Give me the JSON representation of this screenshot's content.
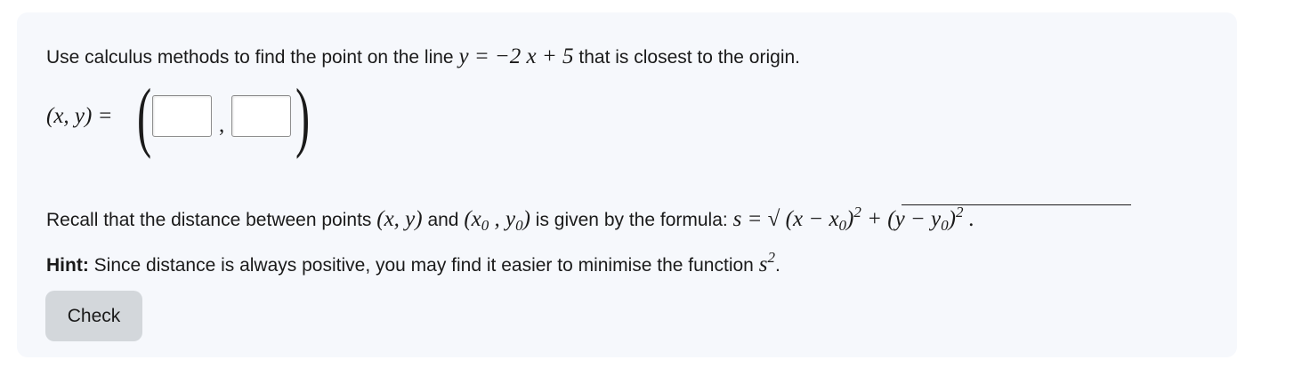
{
  "question": {
    "intro": "Use calculus methods to find the point on the line",
    "line_equation": "y = −2 x + 5",
    "outro": "that is closest to the origin."
  },
  "answer": {
    "lhs": "(x, y) =",
    "comma": ",",
    "x_value": "",
    "y_value": ""
  },
  "recall": {
    "prefix": "Recall that the distance between points",
    "point1": "(x, y)",
    "and": "and",
    "point2_open": "(x",
    "point2_sub0": "0",
    "point2_mid": " , y",
    "point2_sub1": "0",
    "point2_close": ")",
    "mid": "is given by the formula:",
    "formula_lhs": "s =",
    "radical": "√",
    "term1_open": "(x − x",
    "term1_sub": "0",
    "term1_close": ")",
    "term1_sup": "2",
    "plus": " + ",
    "term2_open": "(y − y",
    "term2_sub": "0",
    "term2_close": ")",
    "term2_sup": "2",
    "period": " ."
  },
  "hint": {
    "label": "Hint:",
    "text": "Since distance is always positive, you may find it easier to minimise the function",
    "var": "s",
    "sup": "2",
    "period": "."
  },
  "check_button": {
    "label": "Check"
  }
}
